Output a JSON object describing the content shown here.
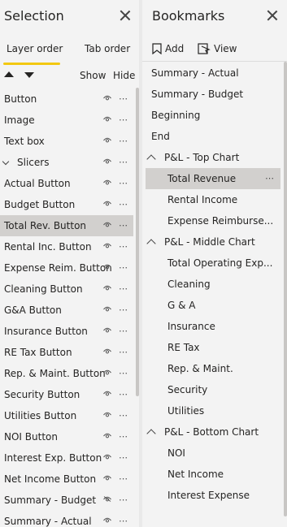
{
  "selection": {
    "title": "Selection",
    "tabs": [
      "Layer order",
      "Tab order"
    ],
    "show_label": "Show",
    "hide_label": "Hide",
    "items": [
      {
        "label": "Button",
        "visible": true
      },
      {
        "label": "Image",
        "visible": true
      },
      {
        "label": "Text box",
        "visible": true
      },
      {
        "label": "Slicers",
        "visible": true,
        "group": true
      },
      {
        "label": "Actual Button",
        "visible": true
      },
      {
        "label": "Budget Button",
        "visible": true
      },
      {
        "label": "Total Rev. Button",
        "visible": true,
        "selected": true
      },
      {
        "label": "Rental Inc. Button",
        "visible": true
      },
      {
        "label": "Expense Reim. Button",
        "visible": true
      },
      {
        "label": "Cleaning Button",
        "visible": true
      },
      {
        "label": "G&A Button",
        "visible": true
      },
      {
        "label": "Insurance Button",
        "visible": true
      },
      {
        "label": "RE Tax Button",
        "visible": true
      },
      {
        "label": "Rep. & Maint. Button",
        "visible": true
      },
      {
        "label": "Security Button",
        "visible": true
      },
      {
        "label": "Utilities Button",
        "visible": true
      },
      {
        "label": "NOI Button",
        "visible": true
      },
      {
        "label": "Interest Exp. Button",
        "visible": true
      },
      {
        "label": "Net Income Button",
        "visible": true
      },
      {
        "label": "Summary - Budget",
        "visible": false
      },
      {
        "label": "Summary - Actual",
        "visible": true
      }
    ]
  },
  "bookmarks": {
    "title": "Bookmarks",
    "add_label": "Add",
    "view_label": "View",
    "items": [
      {
        "label": "Summary - Actual",
        "level": 0
      },
      {
        "label": "Summary - Budget",
        "level": 0
      },
      {
        "label": "Beginning",
        "level": 0
      },
      {
        "label": "End",
        "level": 0
      },
      {
        "label": "P&L - Top Chart",
        "level": 0,
        "group": true
      },
      {
        "label": "Total Revenue",
        "level": 1,
        "selected": true
      },
      {
        "label": "Rental Income",
        "level": 1
      },
      {
        "label": "Expense Reimburse...",
        "level": 1
      },
      {
        "label": "P&L - Middle Chart",
        "level": 0,
        "group": true
      },
      {
        "label": "Total Operating Exp...",
        "level": 1
      },
      {
        "label": "Cleaning",
        "level": 1
      },
      {
        "label": "G & A",
        "level": 1
      },
      {
        "label": "Insurance",
        "level": 1
      },
      {
        "label": "RE Tax",
        "level": 1
      },
      {
        "label": "Rep. & Maint.",
        "level": 1
      },
      {
        "label": "Security",
        "level": 1
      },
      {
        "label": "Utilities",
        "level": 1
      },
      {
        "label": "P&L - Bottom Chart",
        "level": 0,
        "group": true
      },
      {
        "label": "NOI",
        "level": 1
      },
      {
        "label": "Net Income",
        "level": 1
      },
      {
        "label": "Interest Expense",
        "level": 1
      }
    ]
  },
  "colors": {
    "accent": "#f2c811",
    "selected_row": "#d2d0ce",
    "pane_bg": "#f3f3f3"
  }
}
